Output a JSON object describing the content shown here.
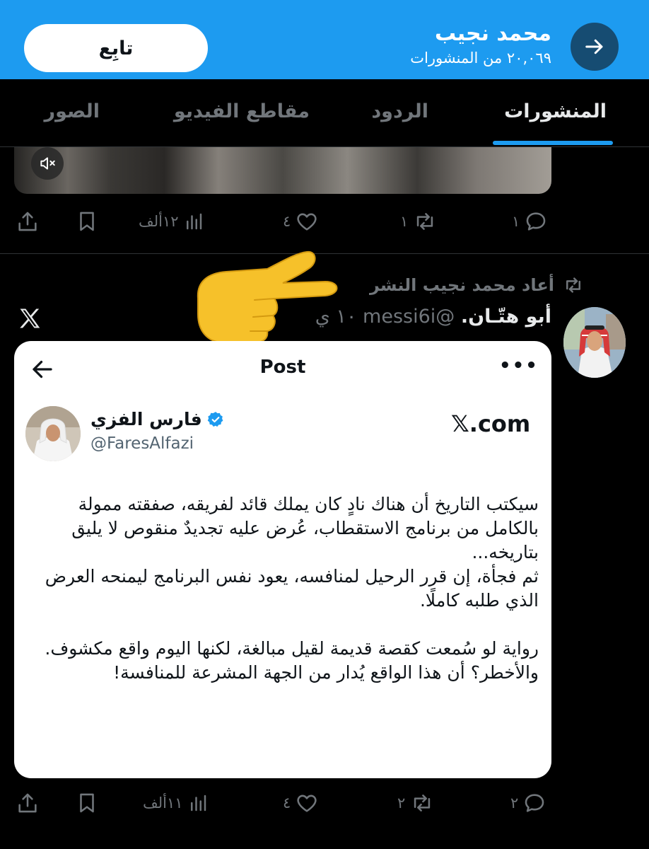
{
  "header": {
    "name": "محمد نجيب",
    "post_count": "٢٠,٠٦٩ من المنشورات",
    "follow_label": "تابِع"
  },
  "tabs": [
    {
      "label": "المنشورات",
      "active": true
    },
    {
      "label": "الردود",
      "active": false
    },
    {
      "label": "مقاطع الفيديو",
      "active": false
    },
    {
      "label": "الصور",
      "active": false
    }
  ],
  "post1": {
    "replies": "١",
    "reposts": "١",
    "likes": "٤",
    "views": "١٢ألف"
  },
  "retweet": {
    "label": "أعاد محمد نجيب النشر"
  },
  "post2": {
    "author_name": "أبو هتّـان.",
    "author_handle": "@messi6i",
    "time": "١٠ ي",
    "replies": "٢",
    "reposts": "٢",
    "likes": "٤",
    "views": "١١ألف"
  },
  "card": {
    "title": "Post",
    "more": "•••",
    "name": "فارس الفزي",
    "handle": "@FaresAlfazi",
    "brand": "𝕏.com",
    "lines": [
      "سيكتب التاريخ أن هناك نادٍ كان يملك قائد لفريقه، صفقته ممولة بالكامل من برنامج الاستقطاب، عُرض عليه تجديدٌ منقوص لا يليق بتاريخه...",
      "ثم فجأة، إن قرر الرحيل لمنافسه، يعود نفس البرنامج ليمنحه العرض الذي طلبه كاملًا.",
      "",
      "رواية لو سُمعت كقصة قديمة لقيل مبالغة، لكنها اليوم واقع مكشوف.",
      "والأخطر؟ أن هذا الواقع يُدار من الجهة المشرعة للمنافسة!"
    ]
  },
  "colors": {
    "header_bg": "#1d9bf0",
    "accent": "#1d9bf0",
    "muted": "#71767b"
  }
}
